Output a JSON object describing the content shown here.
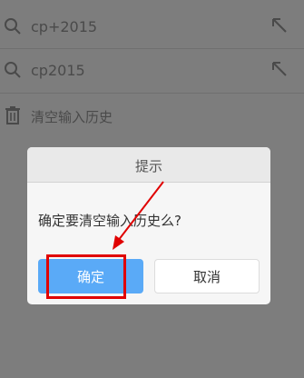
{
  "history": {
    "items": [
      {
        "text": "cp+2015"
      },
      {
        "text": "cp2015"
      }
    ],
    "clear_label": "清空输入历史"
  },
  "dialog": {
    "title": "提示",
    "message": "确定要清空输入历史么?",
    "confirm_label": "确定",
    "cancel_label": "取消"
  },
  "colors": {
    "overlay": "#7d7d7d",
    "confirm_button": "#5aaaf7",
    "annotation": "#e00000"
  }
}
